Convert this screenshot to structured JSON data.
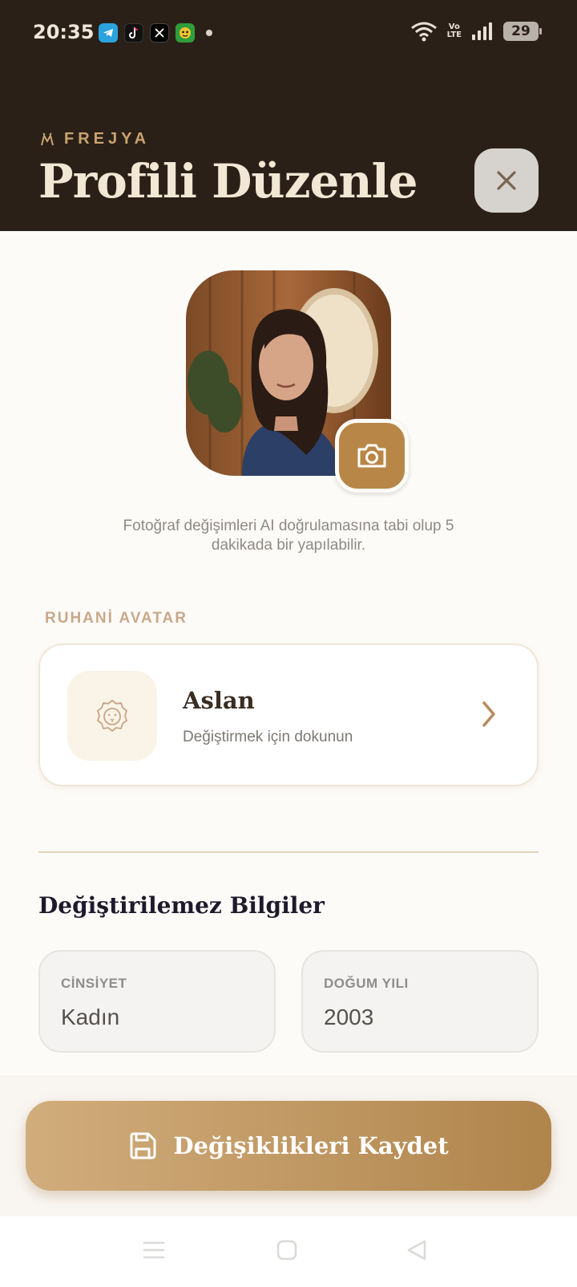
{
  "status_bar": {
    "time": "20:35",
    "apps": [
      "telegram-icon",
      "tiktok-icon",
      "x-icon",
      "game-icon"
    ],
    "volte_top": "Vo",
    "volte_bottom": "LTE",
    "battery": "29"
  },
  "header": {
    "brand": "FREJYA",
    "title": "Profili Düzenle"
  },
  "photo": {
    "note": "Fotoğraf değişimleri AI doğrulamasına tabi olup 5 dakikada bir yapılabilir."
  },
  "avatar_section": {
    "label": "RUHANİ AVATAR",
    "name": "Aslan",
    "hint": "Değiştirmek için dokunun"
  },
  "fixed_info": {
    "title": "Değiştirilemez Bilgiler",
    "gender_label": "CİNSİYET",
    "gender_value": "Kadın",
    "birth_label": "DOĞUM YILI",
    "birth_value": "2003"
  },
  "actions": {
    "save_label": "Değişiklikleri Kaydet"
  },
  "colors": {
    "header_bg": "#2b2017",
    "accent": "#b88747",
    "accent_light": "#d1ad7c"
  }
}
